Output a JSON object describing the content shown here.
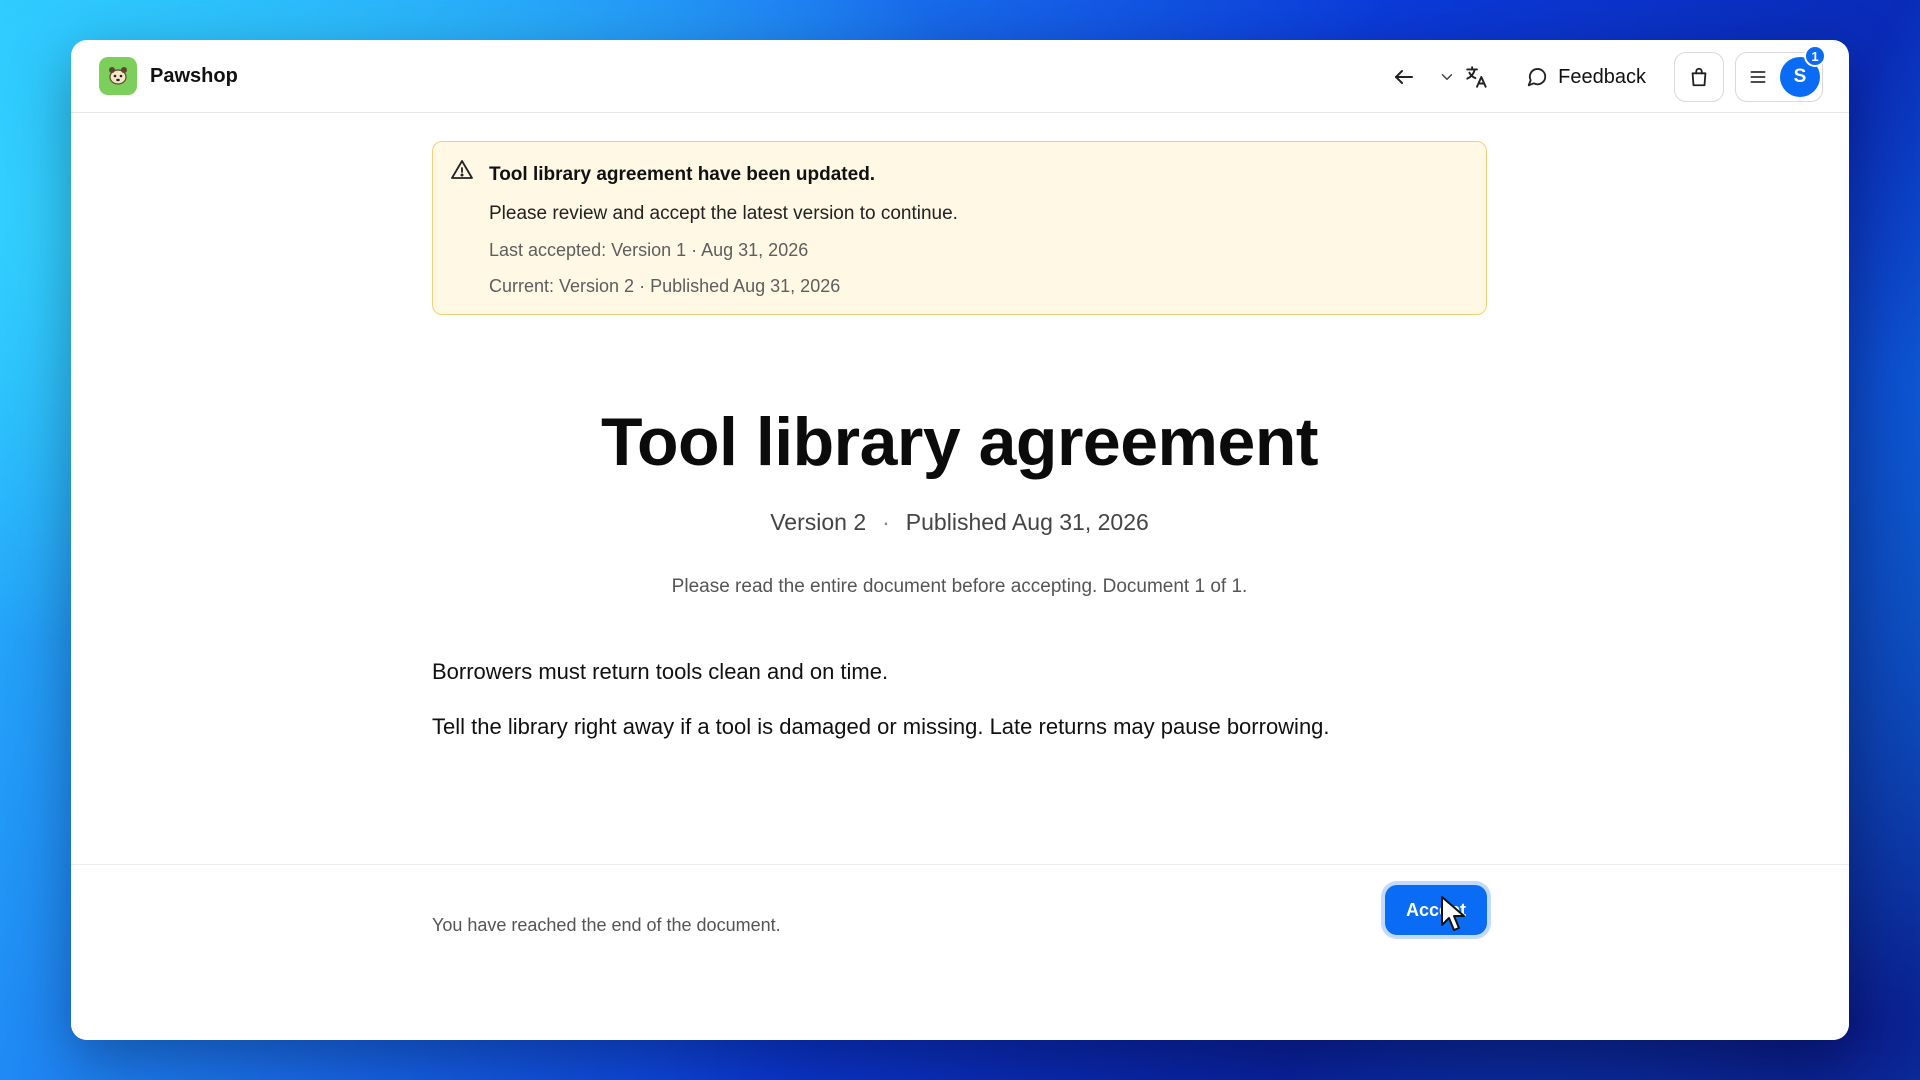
{
  "header": {
    "brand_name": "Pawshop",
    "feedback_label": "Feedback",
    "notification_count": "1",
    "avatar_initial": "S"
  },
  "notice": {
    "title": "Tool library agreement have been updated.",
    "body": "Please review and accept the latest version to continue.",
    "last_accepted": "Last accepted: Version 1 · Aug 31, 2026",
    "current": "Current: Version 2 · Published Aug 31, 2026"
  },
  "document": {
    "title": "Tool library agreement",
    "version": "Version 2",
    "separator": "·",
    "published": "Published Aug 31, 2026",
    "instruction": "Please read the entire document before accepting. Document 1 of 1.",
    "paragraphs": [
      "Borrowers must return tools clean and on time.",
      "Tell the library right away if a tool is damaged or missing. Late returns may pause borrowing."
    ]
  },
  "footer": {
    "status_text": "You have reached the end of the document.",
    "accept_label": "Accept"
  },
  "colors": {
    "accent": "#0a6cf5",
    "brand_logo_bg": "#7ccf5a",
    "notice_bg": "#fff8e5",
    "notice_border": "#f2d17b"
  }
}
